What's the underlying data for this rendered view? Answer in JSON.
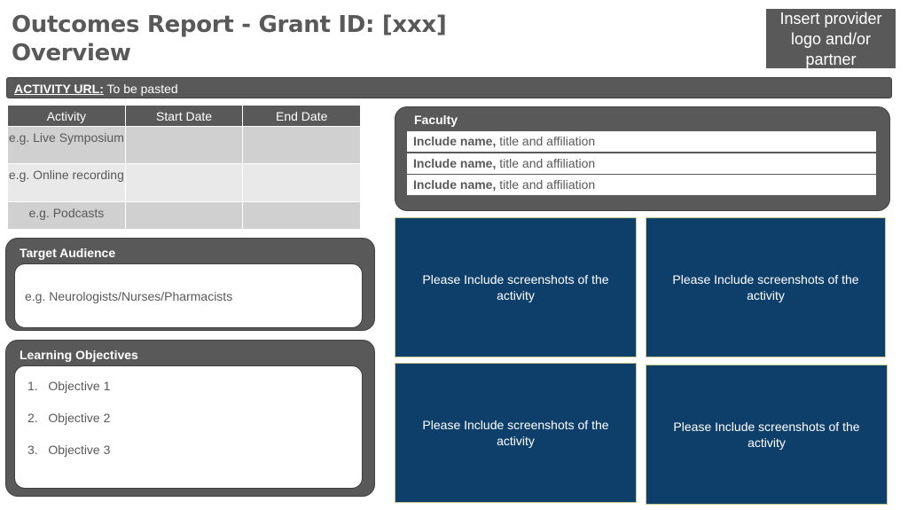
{
  "header": {
    "title_line1": "Outcomes Report - Grant ID: [xxx]",
    "title_line2": "Overview",
    "logo_placeholder": "Insert provider logo and/or partner"
  },
  "url_bar": {
    "label": "ACTIVITY URL",
    "colon": ":",
    "value": " To be pasted"
  },
  "activity_table": {
    "headers": [
      "Activity",
      "Start Date",
      "End Date"
    ],
    "rows": [
      {
        "activity": "e.g. Live Symposium",
        "start": "",
        "end": ""
      },
      {
        "activity": "e.g. Online recording",
        "start": "",
        "end": ""
      },
      {
        "activity": "e.g. Podcasts",
        "start": "",
        "end": ""
      }
    ]
  },
  "target_audience": {
    "title": "Target Audience",
    "text": "e.g. Neurologists/Nurses/Pharmacists"
  },
  "learning_objectives": {
    "title": "Learning Objectives",
    "items": [
      {
        "num": "1.",
        "text": "Objective 1"
      },
      {
        "num": "2.",
        "text": "Objective 2"
      },
      {
        "num": "3.",
        "text": "Objective 3"
      }
    ]
  },
  "faculty": {
    "title": "Faculty",
    "rows": [
      {
        "name": "Include name,",
        "rest": " title and affiliation"
      },
      {
        "name": "Include name,",
        "rest": " title and affiliation"
      },
      {
        "name": "Include name,",
        "rest": " title and affiliation"
      }
    ]
  },
  "screenshots": [
    "Please Include screenshots of the activity",
    "Please Include screenshots of the activity",
    "Please Include screenshots of the activity",
    "Please Include screenshots of the activity"
  ],
  "colors": {
    "panel_gray": "#595959",
    "screenshot_blue": "#0e3e6a",
    "text_gray": "#595959"
  }
}
